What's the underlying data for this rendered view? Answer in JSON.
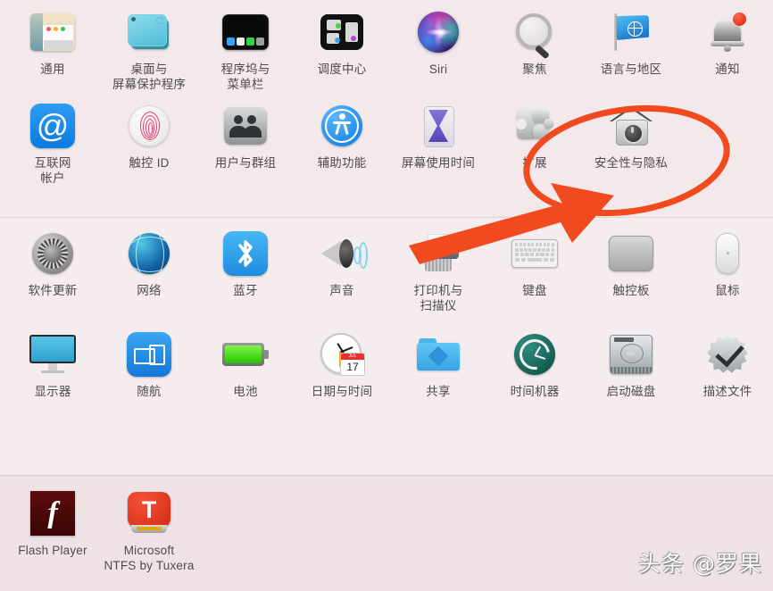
{
  "window": {
    "app": "System Preferences",
    "background": "#f3eaec"
  },
  "annotation": {
    "color": "#f04a1e",
    "highlight_target": "安全性与隐私",
    "shapes": [
      "ellipse",
      "arrow"
    ]
  },
  "watermark": {
    "text": "头条 @罗果"
  },
  "sections": [
    {
      "name": "personal",
      "rows": [
        [
          {
            "label": "通用",
            "icon": "general-icon"
          },
          {
            "label": "桌面与\n屏幕保护程序",
            "icon": "desktop-screensaver-icon"
          },
          {
            "label": "程序坞与\n菜单栏",
            "icon": "dock-menubar-icon"
          },
          {
            "label": "调度中心",
            "icon": "mission-control-icon"
          },
          {
            "label": "Siri",
            "icon": "siri-icon"
          },
          {
            "label": "聚焦",
            "icon": "spotlight-icon"
          },
          {
            "label": "语言与地区",
            "icon": "language-region-icon"
          },
          {
            "label": "通知",
            "icon": "notifications-icon"
          }
        ],
        [
          {
            "label": "互联网\n帐户",
            "icon": "internet-accounts-icon"
          },
          {
            "label": "触控 ID",
            "icon": "touch-id-icon"
          },
          {
            "label": "用户与群组",
            "icon": "users-groups-icon"
          },
          {
            "label": "辅助功能",
            "icon": "accessibility-icon"
          },
          {
            "label": "屏幕使用时间",
            "icon": "screen-time-icon"
          },
          {
            "label": "扩展",
            "icon": "extensions-icon"
          },
          {
            "label": "安全性与隐私",
            "icon": "security-privacy-icon"
          }
        ]
      ]
    },
    {
      "name": "hardware",
      "rows": [
        [
          {
            "label": "软件更新",
            "icon": "software-update-icon"
          },
          {
            "label": "网络",
            "icon": "network-icon"
          },
          {
            "label": "蓝牙",
            "icon": "bluetooth-icon"
          },
          {
            "label": "声音",
            "icon": "sound-icon"
          },
          {
            "label": "打印机与\n扫描仪",
            "icon": "printers-scanners-icon"
          },
          {
            "label": "键盘",
            "icon": "keyboard-icon"
          },
          {
            "label": "触控板",
            "icon": "trackpad-icon"
          },
          {
            "label": "鼠标",
            "icon": "mouse-icon"
          }
        ],
        [
          {
            "label": "显示器",
            "icon": "displays-icon"
          },
          {
            "label": "随航",
            "icon": "sidecar-icon"
          },
          {
            "label": "电池",
            "icon": "battery-icon"
          },
          {
            "label": "日期与时间",
            "icon": "date-time-icon"
          },
          {
            "label": "共享",
            "icon": "sharing-icon"
          },
          {
            "label": "时间机器",
            "icon": "time-machine-icon"
          },
          {
            "label": "启动磁盘",
            "icon": "startup-disk-icon"
          },
          {
            "label": "描述文件",
            "icon": "profiles-icon"
          }
        ]
      ]
    },
    {
      "name": "other",
      "rows": [
        [
          {
            "label": "Flash Player",
            "icon": "flash-player-icon"
          },
          {
            "label": "Microsoft\nNTFS by Tuxera",
            "icon": "tuxera-ntfs-icon"
          }
        ]
      ]
    }
  ],
  "date_time_icon": {
    "month": "JUL",
    "day": "17"
  }
}
